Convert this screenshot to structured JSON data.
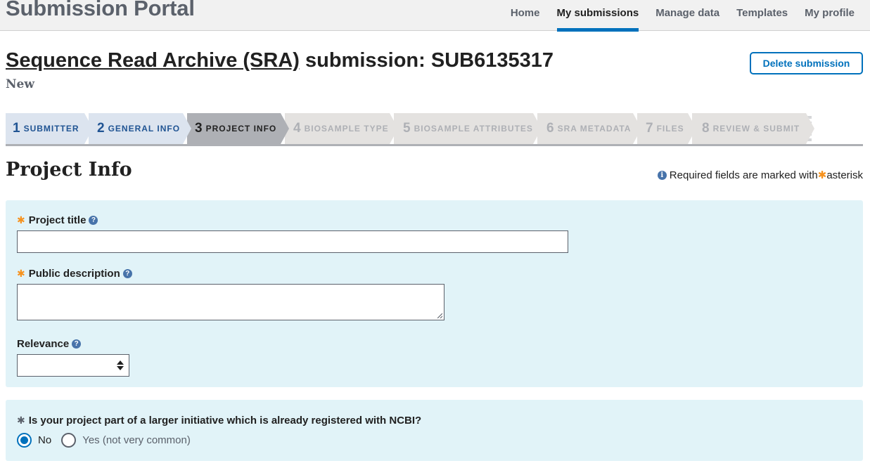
{
  "header": {
    "portal_title": "Submission Portal",
    "nav": [
      {
        "label": "Home",
        "active": false
      },
      {
        "label": "My submissions",
        "active": true
      },
      {
        "label": "Manage data",
        "active": false
      },
      {
        "label": "Templates",
        "active": false
      },
      {
        "label": "My profile",
        "active": false
      }
    ]
  },
  "page": {
    "heading_link": "Sequence Read Archive (SRA)",
    "heading_rest": " submission: SUB6135317",
    "status": "New",
    "delete_button": "Delete submission"
  },
  "stepper": {
    "steps": [
      {
        "number": "1",
        "label": "SUBMITTER",
        "state": "done"
      },
      {
        "number": "2",
        "label": "GENERAL INFO",
        "state": "done"
      },
      {
        "number": "3",
        "label": "PROJECT INFO",
        "state": "current"
      },
      {
        "number": "4",
        "label": "BIOSAMPLE TYPE",
        "state": "pending"
      },
      {
        "number": "5",
        "label": "BIOSAMPLE ATTRIBUTES",
        "state": "pending"
      },
      {
        "number": "6",
        "label": "SRA METADATA",
        "state": "pending"
      },
      {
        "number": "7",
        "label": "FILES",
        "state": "pending"
      },
      {
        "number": "8",
        "label": "REVIEW & SUBMIT",
        "state": "pending"
      }
    ]
  },
  "section": {
    "title": "Project Info",
    "required_note_before": "Required fields are marked with ",
    "required_note_after": " asterisk"
  },
  "form": {
    "project_title": {
      "label": "Project title",
      "value": ""
    },
    "public_description": {
      "label": "Public description",
      "value": ""
    },
    "relevance": {
      "label": "Relevance",
      "selected": ""
    },
    "initiative": {
      "question": "Is your project part of a larger initiative which is already registered with NCBI?",
      "options": [
        "No",
        "Yes (not very common)"
      ],
      "selected": "No"
    }
  },
  "icons": {
    "required": "asterisk-icon",
    "help": "question-circle-icon",
    "info": "info-circle-icon"
  },
  "colors": {
    "accent": "#0071bc",
    "required_star": "#f6921e",
    "panel_bg": "#e1f3f8",
    "step_done": "#dce4ef",
    "step_current": "#aeb0b5"
  }
}
